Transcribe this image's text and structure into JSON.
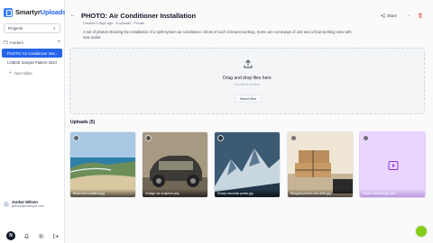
{
  "app": {
    "brand_part1": "Smartyr",
    "brand_part2": "Uploads",
    "accent_color": "#2563eb"
  },
  "sidebar": {
    "workspace": "Projects",
    "folders_label": "Folders",
    "folders": [
      {
        "label": "PHOTO: Air Conditioner Inst...",
        "active": true
      },
      {
        "label": "LGBOE Sample Pattern 2024",
        "active": false
      }
    ],
    "new_folder_label": "New folder",
    "user_name": "Jordan Wilson",
    "user_email": "jwilson@example.com",
    "badge_letter": "N"
  },
  "header": {
    "title": "PHOTO: Air Conditioner Installation",
    "meta": "Created 5 days ago · 5 uploads · Private",
    "description": "A set of photos showing the installation of a split-system air conditioner. Shots of each relevant working. Some are cut-aways of unit and a final working view with new outlet.",
    "share_label": "Share",
    "share_icon": "share-icon",
    "more_icon": "arrow-icon",
    "delete_icon": "trash-icon"
  },
  "dropzone": {
    "title": "Drag and drop files here",
    "subtitle": "or click to browse",
    "button_label": "Select files"
  },
  "uploads": {
    "title": "Uploads (5)",
    "items": [
      {
        "caption": "Beach and coastline.jpg",
        "kind": "image"
      },
      {
        "caption": "Vintage car sculpture.png",
        "kind": "image"
      },
      {
        "caption": "Snowy mountain peaks.jpg",
        "kind": "image"
      },
      {
        "caption": "Wrapped parcels and desk.jpg",
        "kind": "image"
      },
      {
        "caption": "Project walkthrough.mp4",
        "kind": "video"
      }
    ]
  }
}
